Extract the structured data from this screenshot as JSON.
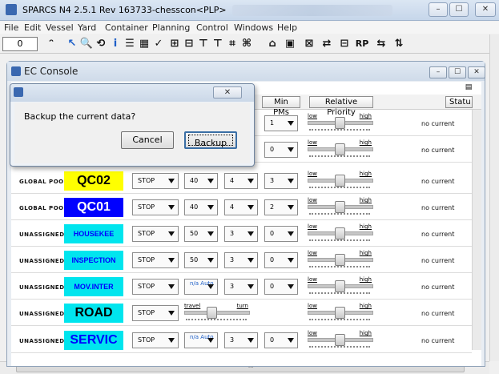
{
  "window": {
    "title": "SPARCS N4 2.5.1  Rev 163733-chesscon<PLP>",
    "min": "–",
    "max": "☐",
    "close": "✕"
  },
  "menu": [
    "File",
    "Edit",
    "Vessel",
    "Yard",
    "Container",
    "Planning",
    "Control",
    "Windows",
    "Help"
  ],
  "toolbar": {
    "zoom_value": "0",
    "tool_texts": [
      "ᵔ",
      "↖",
      "🔍",
      "⟲",
      "i",
      "☰",
      "▦",
      "✓",
      "⊞",
      "⊟",
      "⊤",
      "⊤",
      "⌗",
      "⌘",
      "⌂",
      "▣",
      "⊠",
      "⇄",
      "⊟",
      "RP",
      "⇆",
      "⇅"
    ]
  },
  "ec_console": {
    "title": "EC Console",
    "headers": {
      "min_pms": "Min PMs",
      "relative_priority": "Relative Priority",
      "status": "Statu"
    },
    "rows": [
      {
        "pool": "",
        "crane": "",
        "crane_bg": "",
        "crane_color": "",
        "mode": "",
        "speed": "",
        "c1": "",
        "c2": "1",
        "status": "no current"
      },
      {
        "pool": "",
        "crane": "",
        "crane_bg": "",
        "crane_color": "",
        "mode": "",
        "speed": "",
        "c1": "",
        "c2": "0",
        "status": "no current"
      },
      {
        "pool": "GLOBAL POOL",
        "crane": "QC02",
        "crane_bg": "#ffff00",
        "crane_color": "#000000",
        "mode": "STOP",
        "speed": "40",
        "c1": "4",
        "c2": "3",
        "status": "no current"
      },
      {
        "pool": "GLOBAL POOL",
        "crane": "QC01",
        "crane_bg": "#0000ff",
        "crane_color": "#ffffff",
        "mode": "STOP",
        "speed": "40",
        "c1": "4",
        "c2": "2",
        "status": "no current"
      },
      {
        "pool": "UNASSIGNED",
        "crane": "HOUSEKEE",
        "crane_bg": "#00e5ee",
        "crane_color": "#0000ff",
        "mode": "STOP",
        "speed": "50",
        "c1": "3",
        "c2": "0",
        "status": "no current"
      },
      {
        "pool": "UNASSIGNED",
        "crane": "INSPECTION",
        "crane_bg": "#00e5ee",
        "crane_color": "#0000ff",
        "mode": "STOP",
        "speed": "50",
        "c1": "3",
        "c2": "0",
        "status": "no current"
      },
      {
        "pool": "UNASSIGNED",
        "crane": "MOV.INTER",
        "crane_bg": "#00e5ee",
        "crane_color": "#0000ff",
        "mode": "STOP",
        "speed": "n/a Auto",
        "c1": "3",
        "c2": "0",
        "status": "no current"
      },
      {
        "pool": "UNASSIGNED",
        "crane": "ROAD",
        "crane_bg": "#00e5ee",
        "crane_color": "#000000",
        "mode": "STOP",
        "speed": "",
        "c1": "",
        "c2": "",
        "status": "no current"
      },
      {
        "pool": "UNASSIGNED",
        "crane": "SERVIC",
        "crane_bg": "#00e5ee",
        "crane_color": "#0000ff",
        "mode": "STOP",
        "speed": "n/a Auto",
        "c1": "3",
        "c2": "0",
        "status": "no current"
      }
    ],
    "slider": {
      "low": "low",
      "high": "high",
      "travel": "travel",
      "turn": "turn"
    }
  },
  "dialog": {
    "message": "Backup the current data?",
    "cancel": "Cancel",
    "backup": "Backup",
    "close": "✕"
  },
  "hscroll_mark": "III"
}
